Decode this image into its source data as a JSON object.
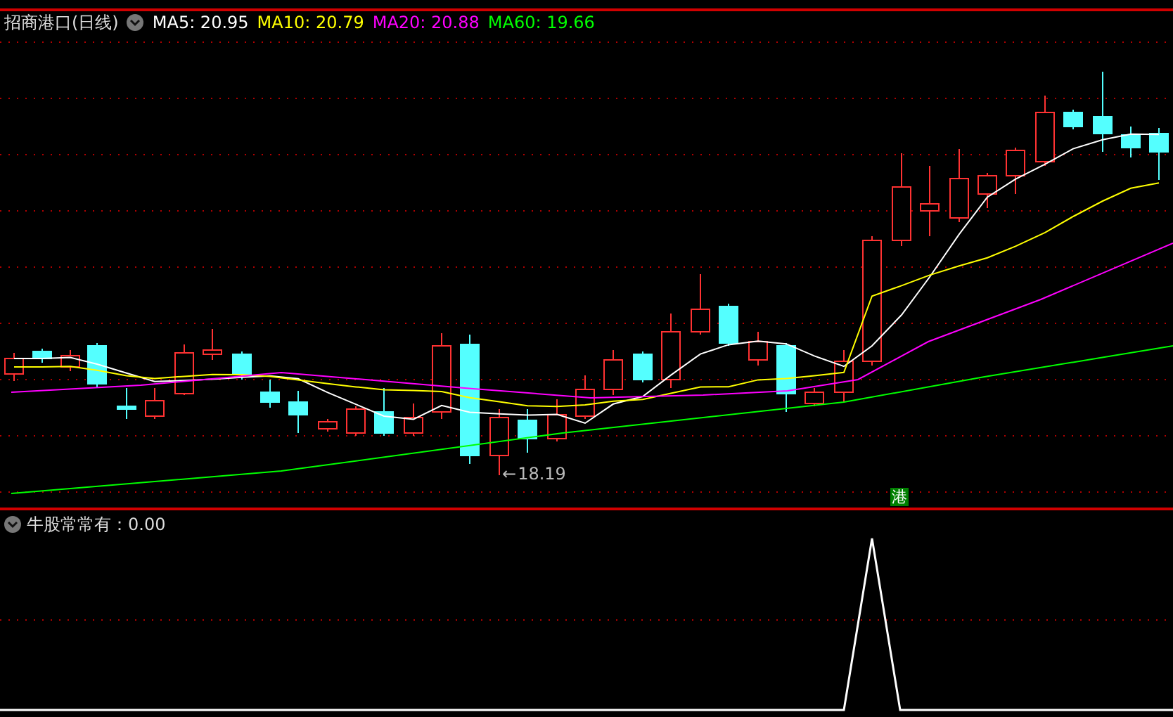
{
  "title": "招商港口(日线)",
  "moving_averages": [
    {
      "label": "MA5:",
      "value": "20.95",
      "color": "#ffffff"
    },
    {
      "label": "MA10:",
      "value": "20.79",
      "color": "#ffff00"
    },
    {
      "label": "MA20:",
      "value": "20.88",
      "color": "#ff00ff"
    },
    {
      "label": "MA60:",
      "value": "19.66",
      "color": "#00ff00"
    }
  ],
  "low_marker": {
    "arrow": "←",
    "value": "18.19"
  },
  "badge": "港",
  "indicator": {
    "name": "牛股常常有",
    "separator": "：",
    "value": "0.00"
  }
}
